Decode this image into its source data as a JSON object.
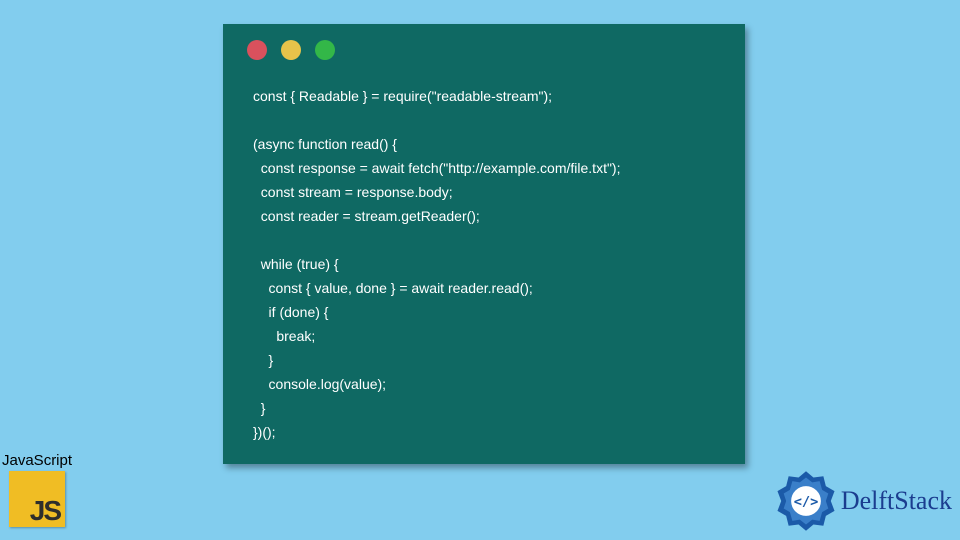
{
  "traffic_light_colors": {
    "red": "#d9515d",
    "yellow": "#e7c34a",
    "green": "#33b748"
  },
  "code_block": "const { Readable } = require(\"readable-stream\");\n\n(async function read() {\n  const response = await fetch(\"http://example.com/file.txt\");\n  const stream = response.body;\n  const reader = stream.getReader();\n\n  while (true) {\n    const { value, done } = await reader.read();\n    if (done) {\n      break;\n    }\n    console.log(value);\n  }\n})();",
  "js_badge": {
    "label": "JavaScript",
    "logo_text": "JS"
  },
  "brand": {
    "name": "DelftStack"
  }
}
